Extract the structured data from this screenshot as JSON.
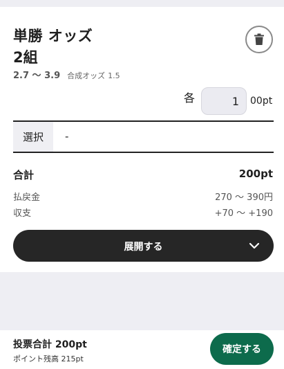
{
  "bet": {
    "title_line1": "単勝 オッズ",
    "title_line2": "2組",
    "odds_range": "2.7 〜 3.9",
    "composite_label": "合成オッズ",
    "composite_value": "1.5"
  },
  "stake": {
    "each_label": "各",
    "quantity": "1",
    "unit_suffix": "00pt"
  },
  "selection": {
    "label": "選択",
    "value": "-"
  },
  "summary": {
    "total_label": "合計",
    "total_value": "200pt",
    "payout_label": "払戻金",
    "payout_value": "270 〜 390円",
    "balance_label": "収支",
    "balance_value": "+70 〜 +190"
  },
  "expand": {
    "label": "展開する",
    "icon": "chevron-down-icon"
  },
  "footer": {
    "vote_total": "投票合計 200pt",
    "points_balance": "ポイント残高 215pt",
    "confirm_label": "確定する"
  },
  "colors": {
    "accent": "#0d6b4c",
    "dark_button": "#262626",
    "background": "#eeeef3"
  }
}
